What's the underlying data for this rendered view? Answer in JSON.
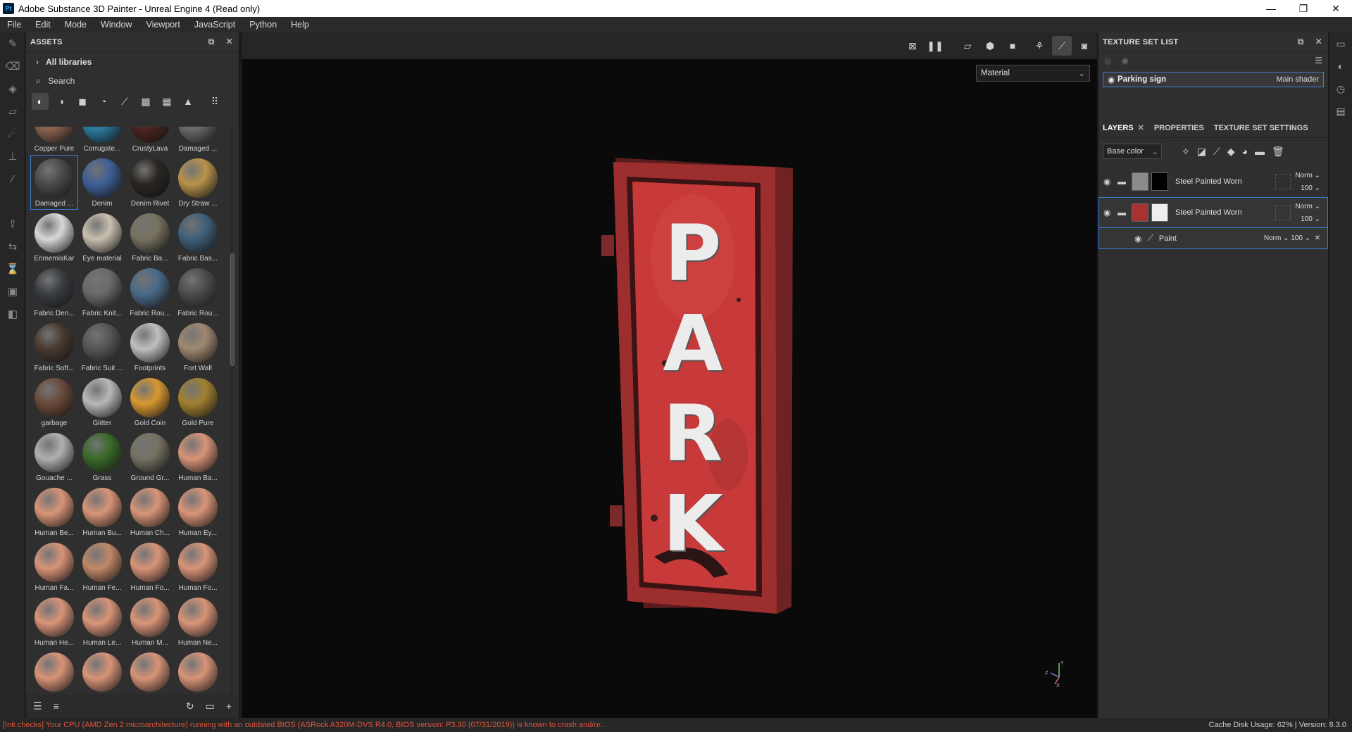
{
  "window": {
    "title": "Adobe Substance 3D Painter - Unreal Engine 4 (Read only)",
    "app_icon_text": "Pt",
    "controls": [
      "—",
      "❐",
      "✕"
    ]
  },
  "menu": [
    "File",
    "Edit",
    "Mode",
    "Window",
    "Viewport",
    "JavaScript",
    "Python",
    "Help"
  ],
  "assets": {
    "title": "ASSETS",
    "library": "All libraries",
    "search_placeholder": "Search",
    "items": [
      {
        "label": "Copper Pure",
        "color": "#8a6150"
      },
      {
        "label": "Corrugate...",
        "color": "#2d7aa0"
      },
      {
        "label": "CrustyLava",
        "color": "#4a2420"
      },
      {
        "label": "Damaged ...",
        "color": "#6a6a6a"
      },
      {
        "label": "Damaged ...",
        "color": "#4a4a4a"
      },
      {
        "label": "Denim",
        "color": "#3e5f95"
      },
      {
        "label": "Denim Rivet",
        "color": "#2a2622"
      },
      {
        "label": "Dry Straw ...",
        "color": "#b8924a"
      },
      {
        "label": "ErimemisKar",
        "color": "#d8d8d8"
      },
      {
        "label": "Eye material",
        "color": "#c8c0b0"
      },
      {
        "label": "Fabric Ba...",
        "color": "#77715e"
      },
      {
        "label": "Fabric Bas...",
        "color": "#3f5f78"
      },
      {
        "label": "Fabric Den...",
        "color": "#3a3d42"
      },
      {
        "label": "Fabric Knit...",
        "color": "#6a6a6a"
      },
      {
        "label": "Fabric Rou...",
        "color": "#4a6a88"
      },
      {
        "label": "Fabric Rou...",
        "color": "#4c4c4c"
      },
      {
        "label": "Fabric Soft...",
        "color": "#4a3a30"
      },
      {
        "label": "Fabric Suit ...",
        "color": "#555555"
      },
      {
        "label": "Footprints",
        "color": "#c0c0c0"
      },
      {
        "label": "Fort Wall",
        "color": "#a08870"
      },
      {
        "label": "garbage",
        "color": "#6a4a3a"
      },
      {
        "label": "Glitter",
        "color": "#b8b8b8"
      },
      {
        "label": "Gold Coin",
        "color": "#d89830"
      },
      {
        "label": "Gold Pure",
        "color": "#a08030"
      },
      {
        "label": "Gouache ...",
        "color": "#b0b0b0"
      },
      {
        "label": "Grass",
        "color": "#3a6a2a"
      },
      {
        "label": "Ground Gr...",
        "color": "#767262"
      },
      {
        "label": "Human Ba...",
        "color": "#d89478"
      },
      {
        "label": "Human Be...",
        "color": "#d89478"
      },
      {
        "label": "Human Bu...",
        "color": "#d89478"
      },
      {
        "label": "Human Ch...",
        "color": "#d89478"
      },
      {
        "label": "Human Ey...",
        "color": "#d89478"
      },
      {
        "label": "Human Fa...",
        "color": "#d89478"
      },
      {
        "label": "Human Fe...",
        "color": "#c08868"
      },
      {
        "label": "Human Fo...",
        "color": "#d89478"
      },
      {
        "label": "Human Fo...",
        "color": "#d89478"
      },
      {
        "label": "Human He...",
        "color": "#d89478"
      },
      {
        "label": "Human Le...",
        "color": "#d89478"
      },
      {
        "label": "Human M...",
        "color": "#d89478"
      },
      {
        "label": "Human Ne...",
        "color": "#d89478"
      },
      {
        "label": "",
        "color": "#d89478"
      },
      {
        "label": "",
        "color": "#d89478"
      },
      {
        "label": "",
        "color": "#d89478"
      },
      {
        "label": "",
        "color": "#d89478"
      }
    ]
  },
  "viewport": {
    "mode_select": "Material",
    "sign_text": "PARK",
    "sign_color": "#c8393a"
  },
  "texture_set_list": {
    "title": "TEXTURE SET LIST",
    "item_name": "Parking sign",
    "item_shader": "Main shader"
  },
  "tabs": {
    "layers": "LAYERS",
    "properties": "PROPERTIES",
    "texture_set_settings": "TEXTURE SET SETTINGS"
  },
  "layers": {
    "channel": "Base color",
    "items": [
      {
        "name": "Steel Painted Worn",
        "blend": "Norm",
        "opacity": "100"
      },
      {
        "name": "Steel Painted Worn",
        "blend": "Norm",
        "opacity": "100"
      }
    ],
    "sub": {
      "name": "Paint",
      "blend": "Norm",
      "opacity": "100"
    }
  },
  "status": {
    "warning": "[Init checks] Your CPU (AMD Zen 2 microarchitecture) running with an outdated BIOS (ASRock A320M-DVS R4.0, BIOS version: P3.30 (07/31/2019)) is known to crash and/or...",
    "right": "Cache Disk Usage:   62% | Version: 8.3.0"
  }
}
